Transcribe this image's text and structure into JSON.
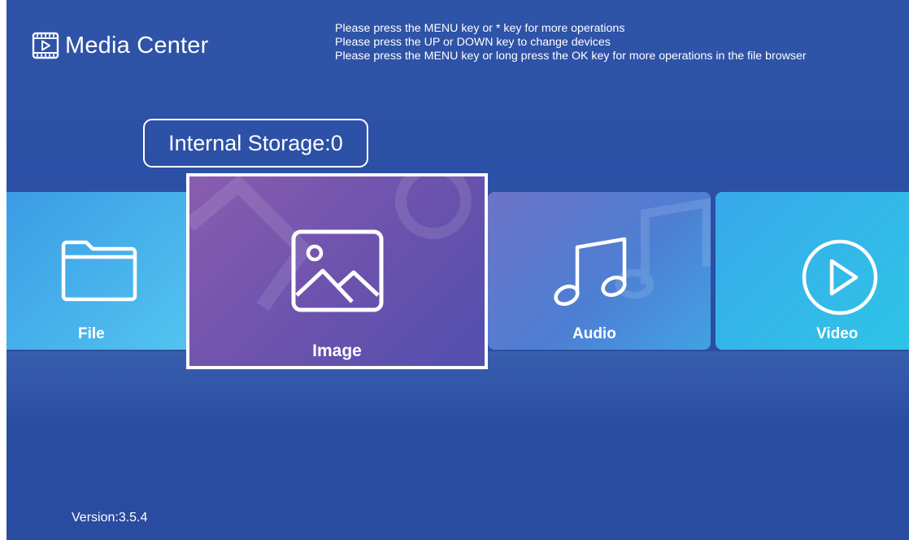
{
  "header": {
    "app_icon": "media-film-icon",
    "title": "Media Center"
  },
  "hints": [
    "Please press the MENU key or * key for more operations",
    "Please press the UP or DOWN key to change devices",
    "Please press the MENU key or long press the OK key for more operations in the file browser"
  ],
  "storage": {
    "label": "Internal Storage:0"
  },
  "tiles": [
    {
      "label": "File",
      "icon": "folder-icon",
      "color": "#45b2ec"
    },
    {
      "label": "Image",
      "icon": "image-icon",
      "color": "#7a57b0",
      "selected": true
    },
    {
      "label": "Audio",
      "icon": "music-note-icon",
      "color": "#5b7fd4"
    },
    {
      "label": "Video",
      "icon": "play-circle-icon",
      "color": "#35b9e8"
    }
  ],
  "footer": {
    "version": "Version:3.5.4"
  },
  "colors": {
    "background": "#2e54a8",
    "text": "#ffffff",
    "selection_border": "#ffffff"
  }
}
